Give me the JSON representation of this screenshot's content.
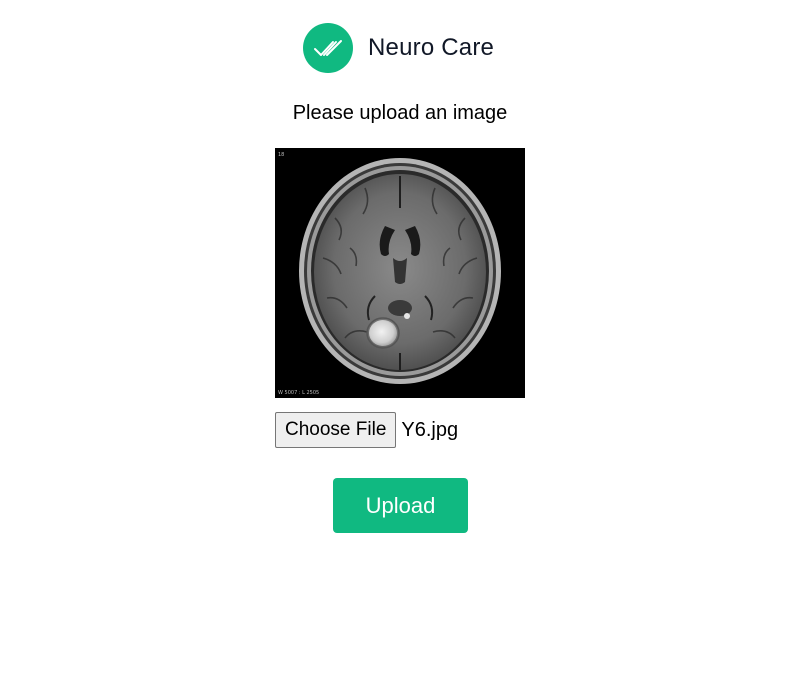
{
  "header": {
    "brand_name": "Neuro Care",
    "logo_icon": "double-check-icon"
  },
  "upload_form": {
    "prompt": "Please upload an image",
    "choose_file_label": "Choose File",
    "selected_file_name": "Y6.jpg",
    "upload_label": "Upload"
  },
  "preview_image": {
    "corner_label": "W 5007 : L 2505",
    "slice_number": "18"
  },
  "colors": {
    "accent": "#10b981",
    "text": "#111827"
  }
}
